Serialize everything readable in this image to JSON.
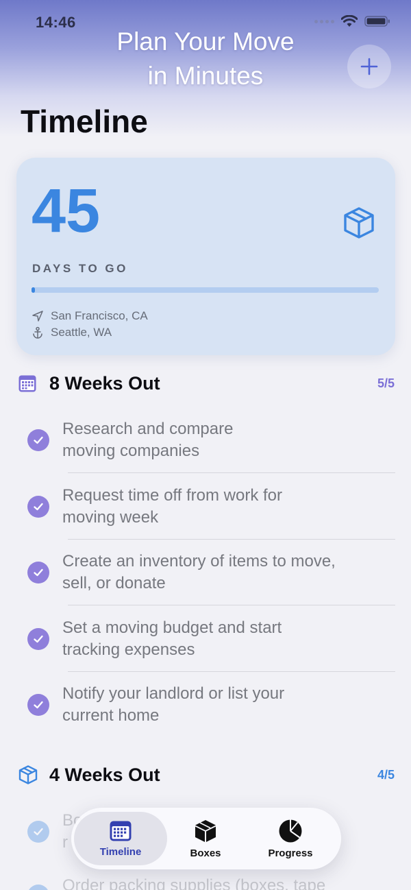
{
  "status_bar": {
    "time": "14:46"
  },
  "hero": {
    "headline_line1": "Plan Your Move",
    "headline_line2": "in Minutes"
  },
  "page_title": "Timeline",
  "countdown": {
    "days": "45",
    "label": "DAYS TO GO",
    "progress": 0.01,
    "origin": "San Francisco, CA",
    "destination": "Seattle, WA",
    "accent_color": "#3b86e0"
  },
  "sections": [
    {
      "title": "8 Weeks Out",
      "count": "5/5",
      "icon": "calendar-icon",
      "color": "#7b6fd6",
      "tasks": [
        {
          "line1": "Research and compare",
          "line2": "moving companies",
          "done": true
        },
        {
          "line1": "Request time off from work for",
          "line2": "moving week",
          "done": true
        },
        {
          "line1": "Create an inventory of items to move,",
          "line2": "sell, or donate",
          "done": true
        },
        {
          "line1": "Set a moving budget and start",
          "line2": "tracking expenses",
          "done": true
        },
        {
          "line1": "Notify your landlord or list your",
          "line2": "current home",
          "done": true
        }
      ]
    },
    {
      "title": "4 Weeks Out",
      "count": "4/5",
      "icon": "cube-icon",
      "color": "#3b86e0",
      "tasks": [
        {
          "line1": "Bo",
          "line2": "r",
          "done": true
        },
        {
          "line1": "Order packing supplies (boxes, tape",
          "line2": "",
          "done": true
        }
      ]
    }
  ],
  "tabbar": {
    "tabs": [
      {
        "label": "Timeline",
        "icon": "calendar-icon",
        "active": true
      },
      {
        "label": "Boxes",
        "icon": "cube-icon",
        "active": false
      },
      {
        "label": "Progress",
        "icon": "pie-chart-icon",
        "active": false
      }
    ]
  }
}
